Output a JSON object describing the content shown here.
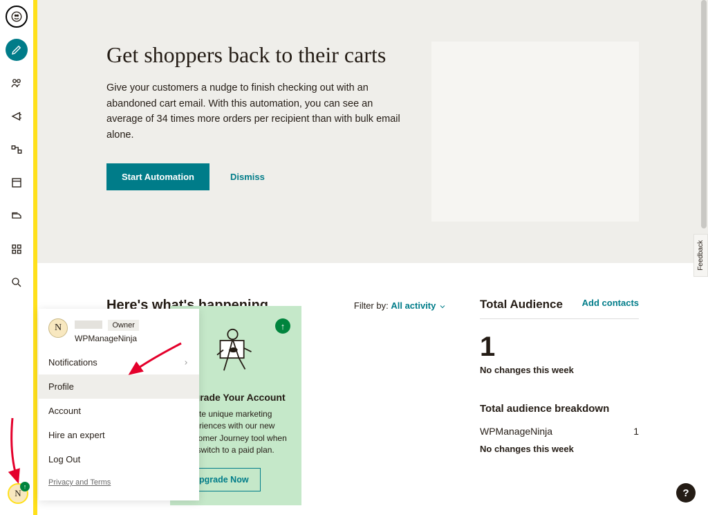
{
  "nav": {
    "items": [
      "create",
      "audience",
      "campaigns",
      "automations",
      "website",
      "content",
      "integrations",
      "search"
    ]
  },
  "hero": {
    "title": "Get shoppers back to their carts",
    "body": "Give your customers a nudge to finish checking out with an abandoned cart email. With this automation, you can see an average of 34 times more orders per recipient than with bulk email alone.",
    "primary": "Start Automation",
    "dismiss": "Dismiss"
  },
  "activity": {
    "heading": "Here's what's happening",
    "filter_label": "Filter by:",
    "filter_value": "All activity"
  },
  "upgrade": {
    "title": "Upgrade Your Account",
    "body": "Create unique marketing experiences with our new Customer Journey tool when you switch to a paid plan.",
    "cta": "Upgrade Now"
  },
  "popover": {
    "avatar_initial": "N",
    "role": "Owner",
    "company": "WPManageNinja",
    "items": [
      "Notifications",
      "Profile",
      "Account",
      "Hire an expert",
      "Log Out"
    ],
    "legal_privacy": "Privacy",
    "legal_and": " and ",
    "legal_terms": "Terms"
  },
  "audience": {
    "title": "Total Audience",
    "add": "Add contacts",
    "total": "1",
    "sub": "No changes this week",
    "breakdown_title": "Total audience breakdown",
    "rows": [
      {
        "name": "WPManageNinja",
        "count": "1"
      }
    ],
    "rows_sub": "No changes this week"
  },
  "misc": {
    "feedback": "Feedback",
    "help": "?",
    "bottom_avatar": "N"
  }
}
